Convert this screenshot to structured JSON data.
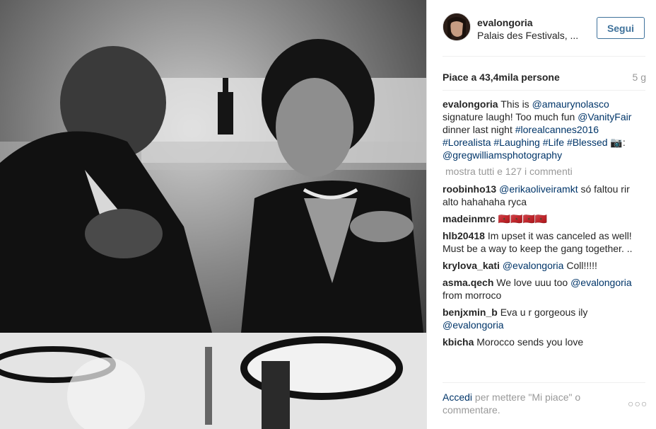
{
  "post": {
    "photo_alt": "Black and white photo of two people laughing at a dinner table"
  },
  "header": {
    "username": "evalongoria",
    "location": "Palais des Festivals, ...",
    "follow_label": "Segui"
  },
  "stats": {
    "likes": "Piace a 43,4mila persone",
    "age": "5 g"
  },
  "caption": {
    "username": "evalongoria",
    "parts": [
      {
        "t": "This is ",
        "link": false
      },
      {
        "t": "@amaurynolasco",
        "link": true
      },
      {
        "t": " signature laugh! Too much fun ",
        "link": false
      },
      {
        "t": "@VanityFair",
        "link": true
      },
      {
        "t": " dinner last night ",
        "link": false
      },
      {
        "t": "#lorealcannes2016",
        "link": true
      },
      {
        "t": " ",
        "link": false
      },
      {
        "t": "#Lorealista",
        "link": true
      },
      {
        "t": " ",
        "link": false
      },
      {
        "t": "#Laughing",
        "link": true
      },
      {
        "t": " ",
        "link": false
      },
      {
        "t": "#Life",
        "link": true
      },
      {
        "t": " ",
        "link": false
      },
      {
        "t": "#Blessed",
        "link": true
      },
      {
        "t": " 📷: ",
        "link": false
      },
      {
        "t": "@gregwilliamsphotography",
        "link": true
      }
    ]
  },
  "load_more": "mostra tutti e 127 i commenti",
  "comments": [
    {
      "user": "roobinho13",
      "parts": [
        {
          "t": "@erikaoliveiramkt",
          "link": true
        },
        {
          "t": " só faltou rir alto hahahaha ryca",
          "link": false
        }
      ]
    },
    {
      "user": "madeinmrc",
      "parts": [
        {
          "t": "🇲🇦🇲🇦🇲🇦🇲🇦",
          "link": false
        }
      ]
    },
    {
      "user": "hlb20418",
      "parts": [
        {
          "t": "Im upset it was canceled as well! Must be a way to keep the gang together. ..",
          "link": false
        }
      ]
    },
    {
      "user": "krylova_kati",
      "parts": [
        {
          "t": "@evalongoria",
          "link": true
        },
        {
          "t": " Coll!!!!!",
          "link": false
        }
      ]
    },
    {
      "user": "asma.qech",
      "parts": [
        {
          "t": "We love uuu too ",
          "link": false
        },
        {
          "t": "@evalongoria",
          "link": true
        },
        {
          "t": " from morroco",
          "link": false
        }
      ]
    },
    {
      "user": "benjxmin_b",
      "parts": [
        {
          "t": "Eva u r gorgeous ily ",
          "link": false
        },
        {
          "t": "@evalongoria",
          "link": true
        }
      ]
    },
    {
      "user": "kbicha",
      "parts": [
        {
          "t": "Morocco sends you love",
          "link": false
        }
      ]
    }
  ],
  "footer": {
    "login": "Accedi",
    "rest": " per mettere \"Mi piace\" o commentare.",
    "more_icon": "ellipsis-icon"
  }
}
